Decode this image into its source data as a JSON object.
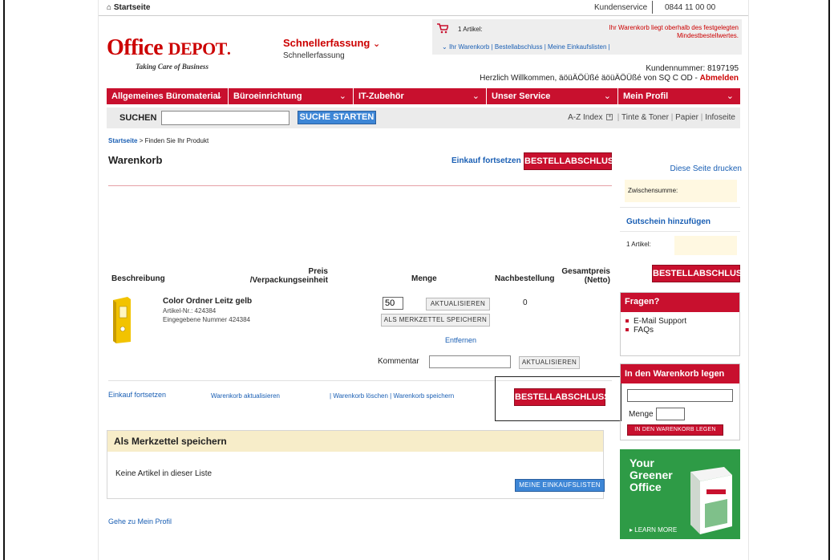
{
  "top": {
    "home_link": "Startseite",
    "home_icon": "house-icon",
    "service_label": "Kundenservice",
    "phone": "0844 11 00 00"
  },
  "logo": {
    "word_main": "Office",
    "word_second": "DEPOT",
    "tagline": "Taking Care of Business",
    "color": "#cc0000"
  },
  "schnell": {
    "title": "Schnellerfassung",
    "subtitle": "Schnellerfassung"
  },
  "cart": {
    "count_label": "1 Artikel:",
    "notice": "Ihr Warenkorb liegt oberhalb des festgelegten Mindestbestellwertes.",
    "links": [
      "Ihr Warenkorb",
      "Bestellabschluss",
      "Meine Einkaufslisten"
    ]
  },
  "account": {
    "kundennummer": "Kundennummer: 8197195",
    "welcome": "Herzlich Willkommen, äöüÄÖÜßé äöüÄÖÜßé von SQ C OD",
    "logout": "Abmelden"
  },
  "nav": {
    "items": [
      "Allgemeines Büromaterial",
      "Büroeinrichtung",
      "IT-Zubehör",
      "Unser Service",
      "Mein Profil"
    ]
  },
  "search": {
    "label": "SUCHEN",
    "value": "",
    "button": "SUCHE STARTEN",
    "quick_links": [
      "A-Z Index",
      "Tinte & Toner",
      "Papier",
      "Infoseite"
    ]
  },
  "breadcrumb": {
    "home": "Startseite",
    "current": "Finden Sie Ihr Produkt"
  },
  "page": {
    "title": "Warenkorb",
    "continue": "Einkauf fortsetzen",
    "checkout": "BESTELLABSCHLUSS",
    "print": "Diese Seite drucken"
  },
  "table": {
    "headers": {
      "desc": "Beschreibung",
      "price_line1": "Preis",
      "price_line2": "/Verpackungseinheit",
      "qty": "Menge",
      "reorder": "Nachbestellung",
      "total_line1": "Gesamtpreis",
      "total_line2": "(Netto)"
    },
    "item": {
      "name": "Color Ordner Leitz gelb",
      "article": "Artikel-Nr.: 424384",
      "entered": "Eingegebene Nummer 424384",
      "qty": "50",
      "update": "AKTUALISIEREN",
      "save_list": "ALS MERKZETTEL SPEICHERN",
      "remove": "Entfernen",
      "reorder_value": "0"
    },
    "comment_label": "Kommentar",
    "comment_value": "",
    "comment_update": "AKTUALISIEREN"
  },
  "actions": {
    "continue": "Einkauf fortsetzen",
    "update_cart": "Warenkorb aktualisieren",
    "delete_cart": "Warenkorb löschen",
    "save_cart": "Warenkorb speichern",
    "checkout": "BESTELLABSCHLUSS"
  },
  "merkzettel": {
    "title": "Als Merkzettel speichern",
    "empty": "Keine Artikel in dieser Liste",
    "button": "MEINE EINKAUFSLISTEN"
  },
  "profile_link": "Gehe zu Mein Profil",
  "sidebar": {
    "subtotal_label": "Zwischensumme:",
    "voucher": "Gutschein hinzufügen",
    "items_label": "1 Artikel:",
    "checkout": "BESTELLABSCHLUSS",
    "questions_title": "Fragen?",
    "question_links": [
      "E-Mail Support",
      "FAQs"
    ],
    "add_title": "In den Warenkorb legen",
    "add_input_value": "",
    "qty_label": "Menge",
    "qty_value": "",
    "add_button": "IN DEN WARENKORB LEGEN",
    "promo_lines": [
      "Your",
      "Greener",
      "Office"
    ],
    "promo_link": "LEARN MORE"
  }
}
